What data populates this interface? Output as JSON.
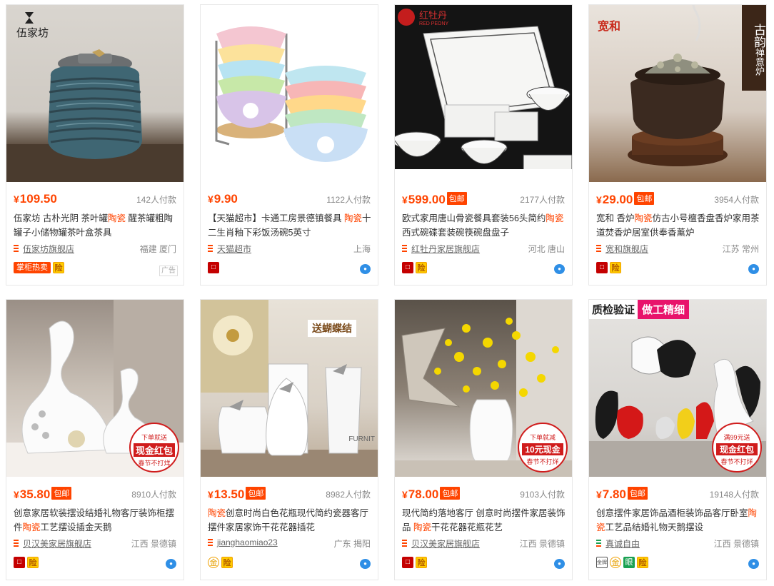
{
  "products": [
    {
      "price": "109.50",
      "baoyou": false,
      "sales": "142人付款",
      "title_parts": [
        {
          "t": "伍家坊 古朴光阴 茶叶罐"
        },
        {
          "t": "陶瓷",
          "hl": true
        },
        {
          "t": " 醒茶罐粗陶罐子小储物罐茶叶盒茶具"
        }
      ],
      "shop": "伍家坊旗舰店",
      "location": "福建 厦门",
      "badges": [
        "掌柜热卖",
        "险"
      ],
      "ad": "广告",
      "brand_text": "伍家坊"
    },
    {
      "price": "9.90",
      "baoyou": false,
      "sales": "1122人付款",
      "title_parts": [
        {
          "t": "【天猫超市】卡通工房景德镇餐具 "
        },
        {
          "t": "陶瓷",
          "hl": true
        },
        {
          "t": "十二生肖釉下彩饭汤碗5英寸"
        }
      ],
      "shop": "天猫超市",
      "location": "上海",
      "badges": [
        "天猫"
      ]
    },
    {
      "price": "599.00",
      "baoyou": true,
      "sales": "2177人付款",
      "title_parts": [
        {
          "t": "欧式家用唐山骨瓷餐具套装56头简约"
        },
        {
          "t": "陶瓷",
          "hl": true
        },
        {
          "t": "西式碗碟套装碗筷碗盘盘子"
        }
      ],
      "shop": "红牡丹家居旗舰店",
      "location": "河北 唐山",
      "badges": [
        "天猫",
        "险"
      ],
      "brand_text": "红牡丹",
      "brand_sub": "RED PEONY"
    },
    {
      "price": "29.00",
      "baoyou": true,
      "sales": "3954人付款",
      "title_parts": [
        {
          "t": "宽和 香炉"
        },
        {
          "t": "陶瓷",
          "hl": true
        },
        {
          "t": "仿古小号檀香盘香炉家用茶道焚香炉居室供奉香薰炉"
        }
      ],
      "shop": "宽和旗舰店",
      "location": "江苏 常州",
      "badges": [
        "天猫",
        "险"
      ],
      "brand_text": "宽和",
      "side_text": "古韵",
      "side_text2": "禅意炉"
    },
    {
      "price": "35.80",
      "baoyou": true,
      "sales": "8910人付款",
      "title_parts": [
        {
          "t": "创意家居软装摆设结婚礼物客厅装饰柜摆件"
        },
        {
          "t": "陶瓷",
          "hl": true
        },
        {
          "t": "工艺摆设插金天鹅"
        }
      ],
      "shop": "贝汉美家居旗舰店",
      "location": "江西 景德镇",
      "badges": [
        "天猫",
        "险"
      ],
      "promo_a": "下单就送",
      "promo_b": "现金红包",
      "promo_c": "春节不打烊"
    },
    {
      "price": "13.50",
      "baoyou": true,
      "sales": "8982人付款",
      "title_parts": [
        {
          "t": "陶瓷",
          "hl": true
        },
        {
          "t": "创意时尚白色花瓶现代简约瓷器客厅摆件家居家饰干花花器插花"
        }
      ],
      "shop": "jianghaomiao23",
      "location": "广东 揭阳",
      "badges": [
        "金",
        "险"
      ],
      "banner": "送蝴蝶结",
      "word": "FURNIT"
    },
    {
      "price": "78.00",
      "baoyou": true,
      "sales": "9103人付款",
      "title_parts": [
        {
          "t": "现代简约落地客厅 创意时尚摆件家居装饰品 "
        },
        {
          "t": "陶瓷",
          "hl": true
        },
        {
          "t": "干花花器花瓶花艺"
        }
      ],
      "shop": "贝汉美家居旗舰店",
      "location": "江西 景德镇",
      "badges": [
        "天猫",
        "险"
      ],
      "promo_a": "下单就减",
      "promo_b": "10元现金",
      "promo_c": "春节不打烊"
    },
    {
      "price": "7.80",
      "baoyou": true,
      "sales": "19148人付款",
      "title_parts": [
        {
          "t": "创意摆件家居饰品酒柜装饰品客厅卧室"
        },
        {
          "t": "陶瓷",
          "hl": true
        },
        {
          "t": "工艺品结婚礼物天鹅摆设"
        }
      ],
      "shop": "真诚自由",
      "location": "江西 景德镇",
      "badges": [
        "金牌",
        "金",
        "眼",
        "险"
      ],
      "banner_a": "质检验证",
      "banner_b": "做工精细",
      "promo_a": "满99元送",
      "promo_b": "现金红包",
      "promo_c": "春节不打烊"
    }
  ]
}
